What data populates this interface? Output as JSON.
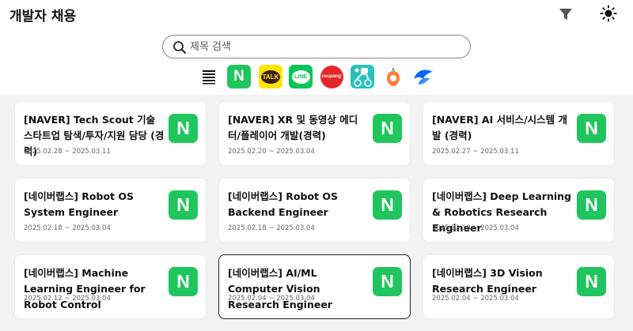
{
  "header": {
    "title": "개발자 채용",
    "filter_icon": "filter-icon",
    "theme_icon": "sun-icon"
  },
  "search": {
    "placeholder": "제목 검색",
    "value": ""
  },
  "companies": [
    {
      "id": "all",
      "icon": "list-icon"
    },
    {
      "id": "naver",
      "logo_text": "N",
      "color": "#21c55d"
    },
    {
      "id": "kakao",
      "logo_text": "TALK",
      "color": "#fee500"
    },
    {
      "id": "line",
      "logo_text": "LINE",
      "color": "#06c755"
    },
    {
      "id": "coupang",
      "logo_text": "coupang",
      "color": "#e52528"
    },
    {
      "id": "baemin",
      "color": "#2ac1bc"
    },
    {
      "id": "daangn",
      "color": "#ff7e36"
    },
    {
      "id": "toss",
      "color": "#0064ff"
    }
  ],
  "jobs": [
    {
      "title": "[NAVER] Tech Scout 기술 스타트업 탐색/투자/지원 담당 (경력)",
      "date": "2025.02.28 ~ 2025.03.11",
      "logo_text": "N"
    },
    {
      "title": "[NAVER] XR 및 동영상 에디터/플레이어 개발(경력)",
      "date": "2025.02.20 ~ 2025.03.04",
      "logo_text": "N"
    },
    {
      "title": "[NAVER] AI 서비스/시스템 개발 (경력)",
      "date": "2025.02.27 ~ 2025.03.11",
      "logo_text": "N"
    },
    {
      "title": "[네이버랩스] Robot OS System Engineer",
      "date": "2025.02.18 ~ 2025.03.04",
      "logo_text": "N"
    },
    {
      "title": "[네이버랩스] Robot OS Backend Engineer",
      "date": "2025.02.18 ~ 2025.03.04",
      "logo_text": "N"
    },
    {
      "title": "[네이버랩스] Deep Learning & Robotics Research Engineer",
      "date": "2025.02.18 ~ 2025.03.04",
      "logo_text": "N"
    },
    {
      "title": "[네이버랩스] Machine Learning Engineer for Robot Control",
      "date": "2025.02.12 ~ 2025.03.04",
      "logo_text": "N"
    },
    {
      "title": "[네이버랩스] AI/ML Computer Vision Research Engineer",
      "date": "2025.02.04 ~ 2025.03.04",
      "logo_text": "N"
    },
    {
      "title": "[네이버랩스] 3D Vision Research Engineer",
      "date": "2025.02.04 ~ 2025.03.04",
      "logo_text": "N"
    }
  ]
}
